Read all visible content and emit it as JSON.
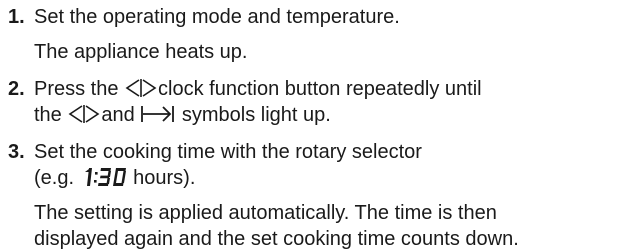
{
  "steps": [
    {
      "number": "1.",
      "instruction": "Set the operating mode and temperature.",
      "result": "The appliance heats up."
    },
    {
      "number": "2.",
      "line1_pre": "Press the ",
      "line1_post": "clock function button repeatedly until",
      "line2_pre": "the ",
      "line2_mid": "and ",
      "line2_post": " symbols light up.",
      "icons": [
        "clock-function-icon",
        "end-time-icon"
      ]
    },
    {
      "number": "3.",
      "line1": "Set the cooking time with the rotary selector",
      "line2_pre": "(e.g. ",
      "display_value": "1:30",
      "line2_post": " hours).",
      "result_line1": "The setting is applied automatically. The time is then",
      "result_line2": "displayed again and the set cooking time counts down."
    }
  ]
}
